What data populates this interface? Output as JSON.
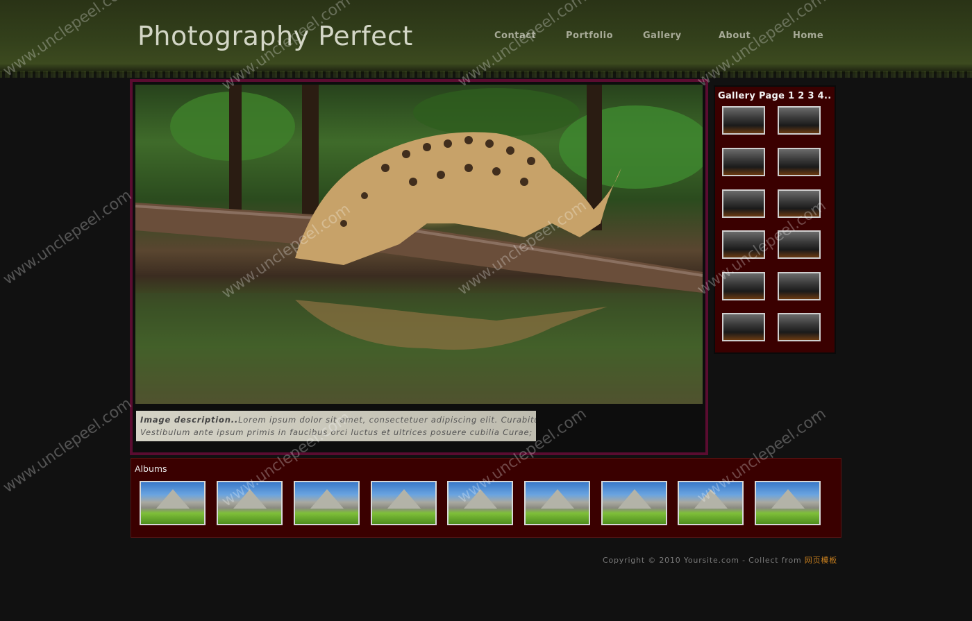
{
  "site": {
    "title": "Photography Perfect"
  },
  "nav": [
    {
      "label": "Contact"
    },
    {
      "label": "Portfolio"
    },
    {
      "label": "Gallery"
    },
    {
      "label": "About"
    },
    {
      "label": "Home"
    }
  ],
  "main": {
    "caption_lead": "Image description..",
    "caption_text": "Lorem ipsum dolor sit amet, consectetuer adipiscing elit. Curabitur nibh.",
    "caption_text2": "Vestibulum ante ipsum primis in faucibus orci luctus et ultrices posuere cubilia Curae;"
  },
  "gallery": {
    "title": "Gallery Page",
    "pages": [
      "1",
      "2",
      "3",
      "4.."
    ]
  },
  "albums": {
    "title": "Albums"
  },
  "footer": {
    "copyright": "Copyright © 2010 Yoursite.com - Collect from ",
    "link_label": "网页模板"
  },
  "watermark": {
    "text": "www.unclepeel.com"
  },
  "colors": {
    "background": "#111111",
    "header_green": "#33401b",
    "frame_plum": "#5a0c30",
    "gallery_bg": "#3a0000",
    "footer_link": "#c87f1e"
  }
}
